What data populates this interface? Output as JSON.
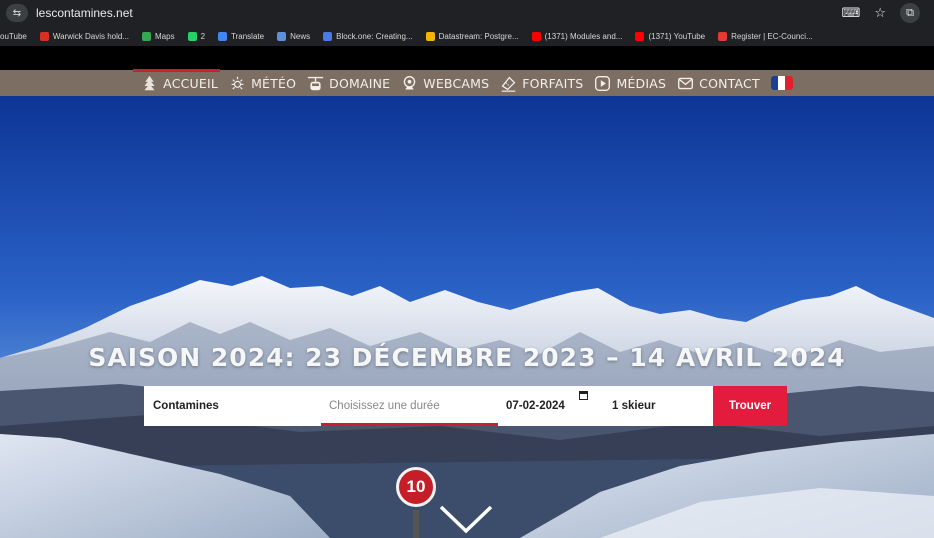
{
  "browser": {
    "url": "lescontamines.net",
    "site_icon": "site-info-icon",
    "bookmarks": [
      {
        "label": "ouTube",
        "color": "#ff0000"
      },
      {
        "label": "Warwick Davis hold...",
        "color": "#d93025"
      },
      {
        "label": "Maps",
        "color": "#34a853"
      },
      {
        "label": "2",
        "color": "#25d366"
      },
      {
        "label": "Translate",
        "color": "#4285f4"
      },
      {
        "label": "News",
        "color": "#5f8fd8"
      },
      {
        "label": "Block.one: Creating...",
        "color": "#4a7be0"
      },
      {
        "label": "Datastream: Postgre...",
        "color": "#f4b400"
      },
      {
        "label": "(1371) Modules and...",
        "color": "#ff0000"
      },
      {
        "label": "(1371) YouTube",
        "color": "#ff0000"
      },
      {
        "label": "Register | EC-Counci...",
        "color": "#e53935"
      }
    ]
  },
  "nav": {
    "items": [
      {
        "label": "ACCUEIL",
        "icon": "tree-icon"
      },
      {
        "label": "MÉTÉO",
        "icon": "sun-icon"
      },
      {
        "label": "DOMAINE",
        "icon": "gondola-icon"
      },
      {
        "label": "WEBCAMS",
        "icon": "webcam-icon"
      },
      {
        "label": "FORFAITS",
        "icon": "ticket-icon"
      },
      {
        "label": "MÉDIAS",
        "icon": "play-icon"
      },
      {
        "label": "CONTACT",
        "icon": "mail-icon"
      }
    ],
    "language_flag_colors": [
      "#1c3f94",
      "#ffffff",
      "#e1202d"
    ],
    "accent": "#c6212e"
  },
  "hero": {
    "title": "SAISON 2024: 23 DÉCEMBRE 2023 – 14 AVRIL 2024"
  },
  "search": {
    "location": "Contamines",
    "duration_placeholder": "Choisissez une durée",
    "date": "07-02-2024",
    "skiers": "1 skieur",
    "submit_label": "Trouver",
    "submit_color": "#e31b3c"
  },
  "slope_sign": {
    "number": "10"
  }
}
